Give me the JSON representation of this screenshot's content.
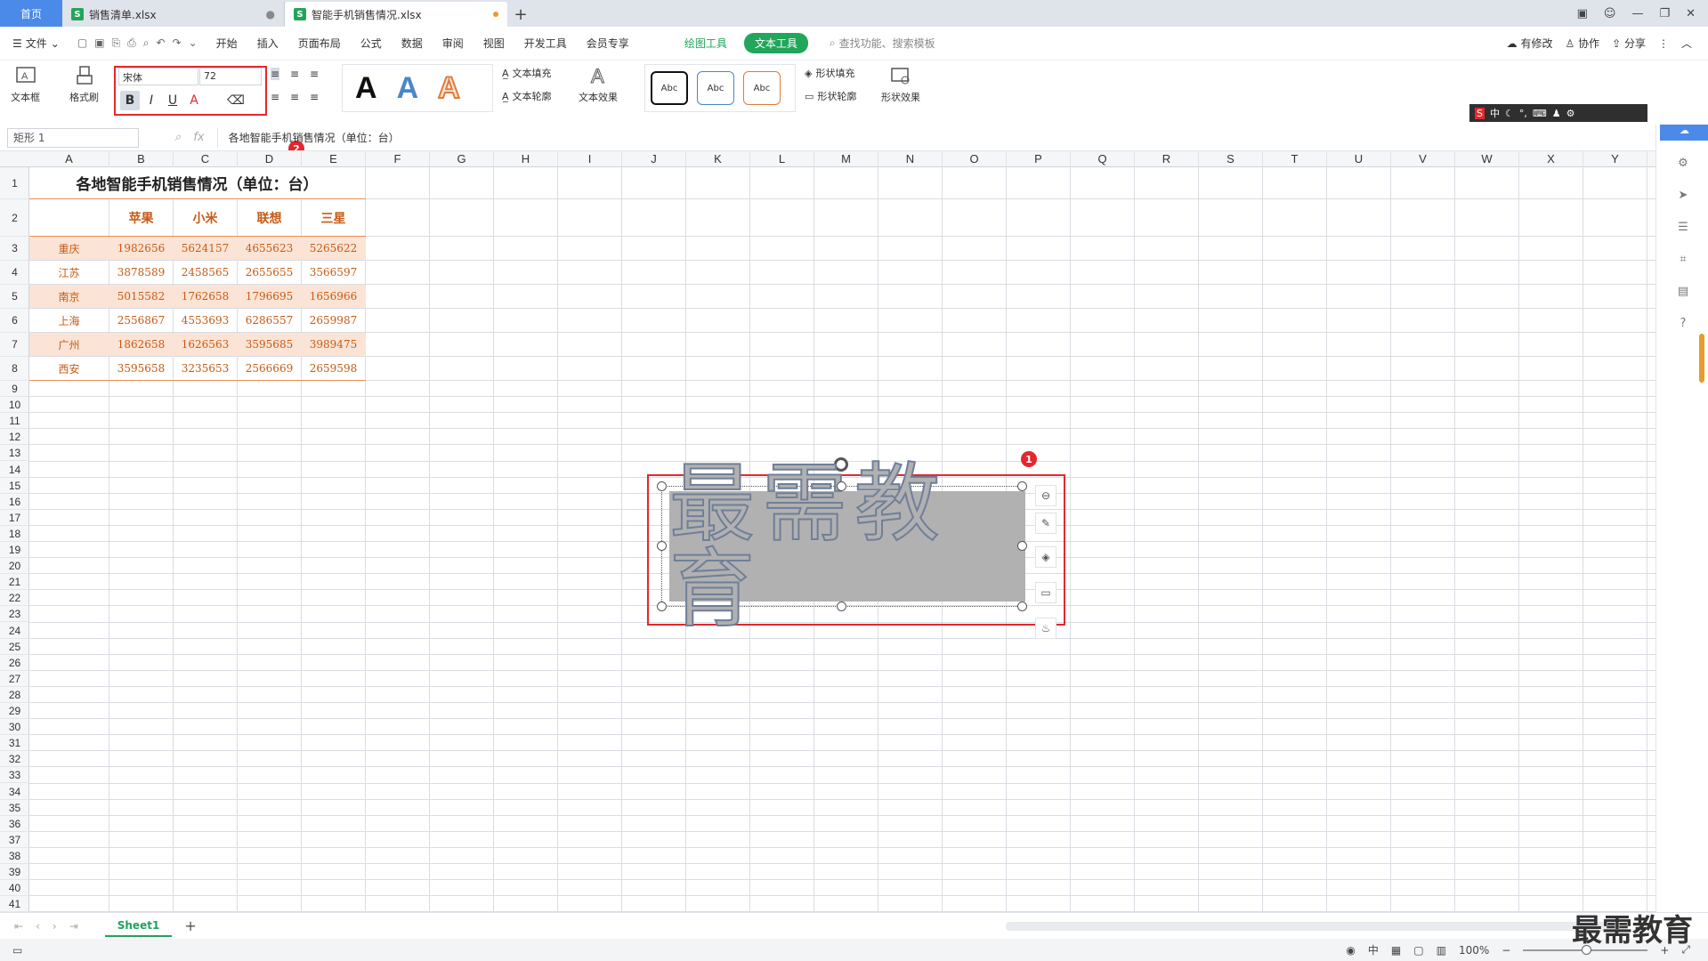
{
  "tabs": {
    "home": "首页",
    "doc1": "销售清单.xlsx",
    "doc2": "智能手机销售情况.xlsx"
  },
  "menu": {
    "file": "文件",
    "items": [
      "开始",
      "插入",
      "页面布局",
      "公式",
      "数据",
      "审阅",
      "视图",
      "开发工具",
      "会员专享"
    ],
    "drawing_tools": "绘图工具",
    "text_tools": "文本工具",
    "search_placeholder": "查找功能、搜索模板",
    "has_changes": "有修改",
    "collaborate": "协作",
    "share": "分享"
  },
  "ribbon": {
    "textbox": "文本框",
    "format_painter": "格式刷",
    "font_name": "宋体",
    "font_size": "72",
    "text_fill": "文本填充",
    "text_outline": "文本轮廓",
    "text_effect": "文本效果",
    "shape_fill": "形状填充",
    "shape_outline": "形状轮廓",
    "shape_effect": "形状效果",
    "abc": "Abc",
    "art_letter": "A"
  },
  "badges": {
    "one": "1",
    "two": "2"
  },
  "ime": {
    "lang": "中"
  },
  "formula_bar": {
    "name_box": "矩形 1",
    "fx": "fx",
    "content": "各地智能手机销售情况（单位：台）"
  },
  "columns": [
    "A",
    "B",
    "C",
    "D",
    "E",
    "F",
    "G",
    "H",
    "I",
    "J",
    "K",
    "L",
    "M",
    "N",
    "O",
    "P",
    "Q",
    "R",
    "S",
    "T",
    "U",
    "V",
    "W",
    "X",
    "Y"
  ],
  "rows": [
    "1",
    "2",
    "3",
    "4",
    "5",
    "6",
    "7",
    "8",
    "9",
    "10",
    "11",
    "12",
    "13",
    "14",
    "15",
    "16",
    "17",
    "18",
    "19",
    "20",
    "21",
    "22",
    "23",
    "24",
    "25",
    "26",
    "27",
    "28",
    "29",
    "30",
    "31",
    "32",
    "33",
    "34",
    "35",
    "36",
    "37",
    "38",
    "39",
    "40",
    "41"
  ],
  "table": {
    "title": "各地智能手机销售情况（单位：台）",
    "headers": [
      "苹果",
      "小米",
      "联想",
      "三星"
    ],
    "data": [
      [
        "重庆",
        "1982656",
        "5624157",
        "4655623",
        "5265622"
      ],
      [
        "江苏",
        "3878589",
        "2458565",
        "2655655",
        "3566597"
      ],
      [
        "南京",
        "5015582",
        "1762658",
        "1796695",
        "1656966"
      ],
      [
        "上海",
        "2556867",
        "4553693",
        "6286557",
        "2659987"
      ],
      [
        "广州",
        "1862658",
        "1626563",
        "3595685",
        "3989475"
      ],
      [
        "西安",
        "3595658",
        "3235653",
        "2566669",
        "2659598"
      ]
    ]
  },
  "textbox_text": "最需教育",
  "sheet_tab": "Sheet1",
  "status": {
    "zoom": "100%"
  },
  "watermark": "最需教育"
}
